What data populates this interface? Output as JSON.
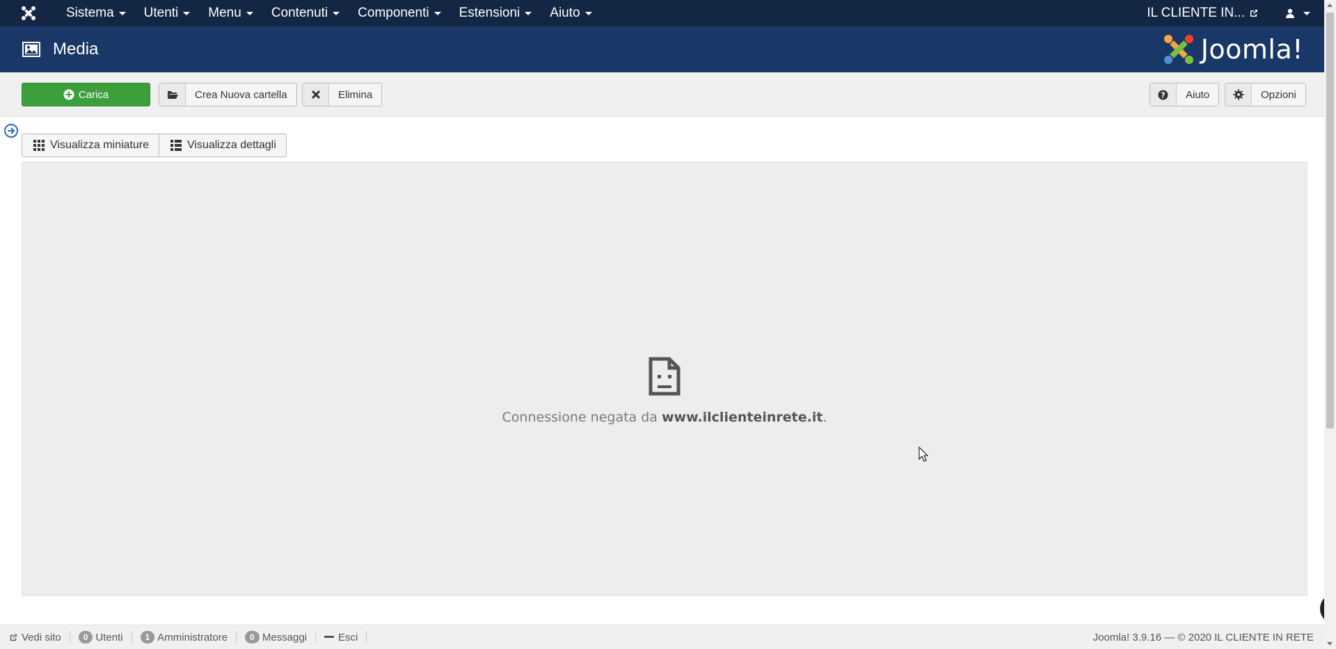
{
  "navbar": {
    "menu": [
      {
        "label": "Sistema"
      },
      {
        "label": "Utenti"
      },
      {
        "label": "Menu"
      },
      {
        "label": "Contenuti"
      },
      {
        "label": "Componenti"
      },
      {
        "label": "Estensioni"
      },
      {
        "label": "Aiuto"
      }
    ],
    "site_label": "IL CLIENTE IN..."
  },
  "header": {
    "title": "Media",
    "brand": "Joomla!"
  },
  "toolbar": {
    "upload_label": "Carica",
    "new_folder_label": "Crea Nuova cartella",
    "delete_label": "Elimina",
    "help_label": "Aiuto",
    "options_label": "Opzioni"
  },
  "views": {
    "thumbnails_label": "Visualizza miniature",
    "details_label": "Visualizza dettagli"
  },
  "error": {
    "prefix": "Connessione negata da ",
    "domain": "www.ilclienteinrete.it",
    "suffix": "."
  },
  "status": {
    "view_site": "Vedi sito",
    "users_count": "0",
    "users_label": "Utenti",
    "admin_count": "1",
    "admin_label": "Amministratore",
    "messages_count": "0",
    "messages_label": "Messaggi",
    "logout": "Esci",
    "copyright": "Joomla! 3.9.16  —  © 2020 IL CLIENTE IN RETE"
  },
  "colors": {
    "navbar": "#132644",
    "header": "#1a3867",
    "upload_button": "#3c9f3c"
  }
}
